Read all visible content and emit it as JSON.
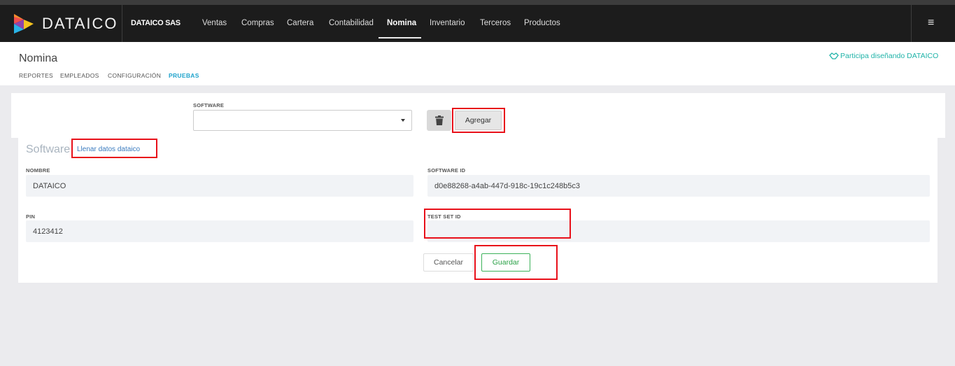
{
  "navbar": {
    "logo_text": "DATAICO",
    "company": "DATAICO SAS",
    "menu": [
      "Ventas",
      "Compras",
      "Cartera",
      "Contabilidad",
      "Nomina",
      "Inventario",
      "Terceros",
      "Productos"
    ],
    "active_menu": "Nomina",
    "hamburger_icon": "≡"
  },
  "header": {
    "title": "Nomina",
    "tabs": [
      "REPORTES",
      "EMPLEADOS",
      "CONFIGURACIÓN",
      "PRUEBAS"
    ],
    "active_tab": "PRUEBAS",
    "participa_link": "Participa diseñando DATAICO"
  },
  "software_selector": {
    "label": "SOFTWARE",
    "value": "",
    "delete_icon": "trash-icon",
    "add_button": "Agregar"
  },
  "software_form": {
    "section_title": "Software",
    "fill_link": "Llenar datos dataico",
    "nombre_label": "NOMBRE",
    "nombre_value": "DATAICO",
    "software_id_label": "SOFTWARE ID",
    "software_id_value": "d0e88268-a4ab-447d-918c-19c1c248b5c3",
    "pin_label": "PIN",
    "pin_value": "4123412",
    "test_set_id_label": "TEST SET ID",
    "test_set_id_value": "",
    "cancel_button": "Cancelar",
    "save_button": "Guardar"
  },
  "colors": {
    "navbar_bg": "#1c1c1c",
    "accent_blue": "#1fa3cc",
    "accent_green": "#2aa147",
    "highlight_red": "#e8101a",
    "page_bg": "#ebebee"
  }
}
